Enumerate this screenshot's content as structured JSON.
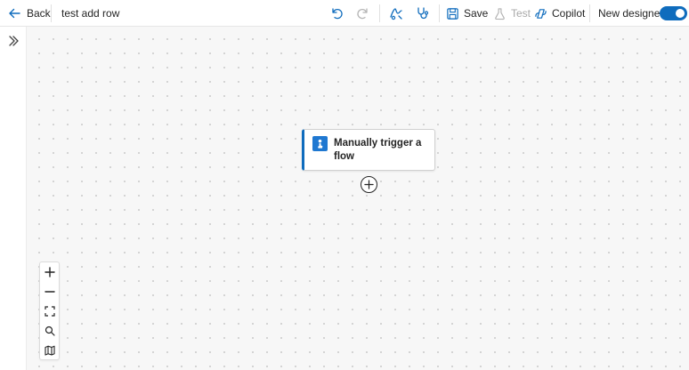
{
  "header": {
    "back_label": "Back",
    "flow_title": "test add row",
    "save_label": "Save",
    "test_label": "Test",
    "copilot_label": "Copilot",
    "new_designer_label": "New designer",
    "new_designer_on": true
  },
  "canvas": {
    "trigger_node": {
      "title": "Manually trigger a flow",
      "icon": "manual-trigger-icon"
    },
    "add_step_icon": "plus-circle-icon"
  },
  "zoom_controls": [
    "zoom-in-icon",
    "zoom-out-icon",
    "fit-view-icon",
    "search-icon",
    "minimap-icon"
  ],
  "colors": {
    "accent": "#0f6cbd",
    "trigger": "#1f78d1",
    "disabled": "#a8a8a8"
  }
}
